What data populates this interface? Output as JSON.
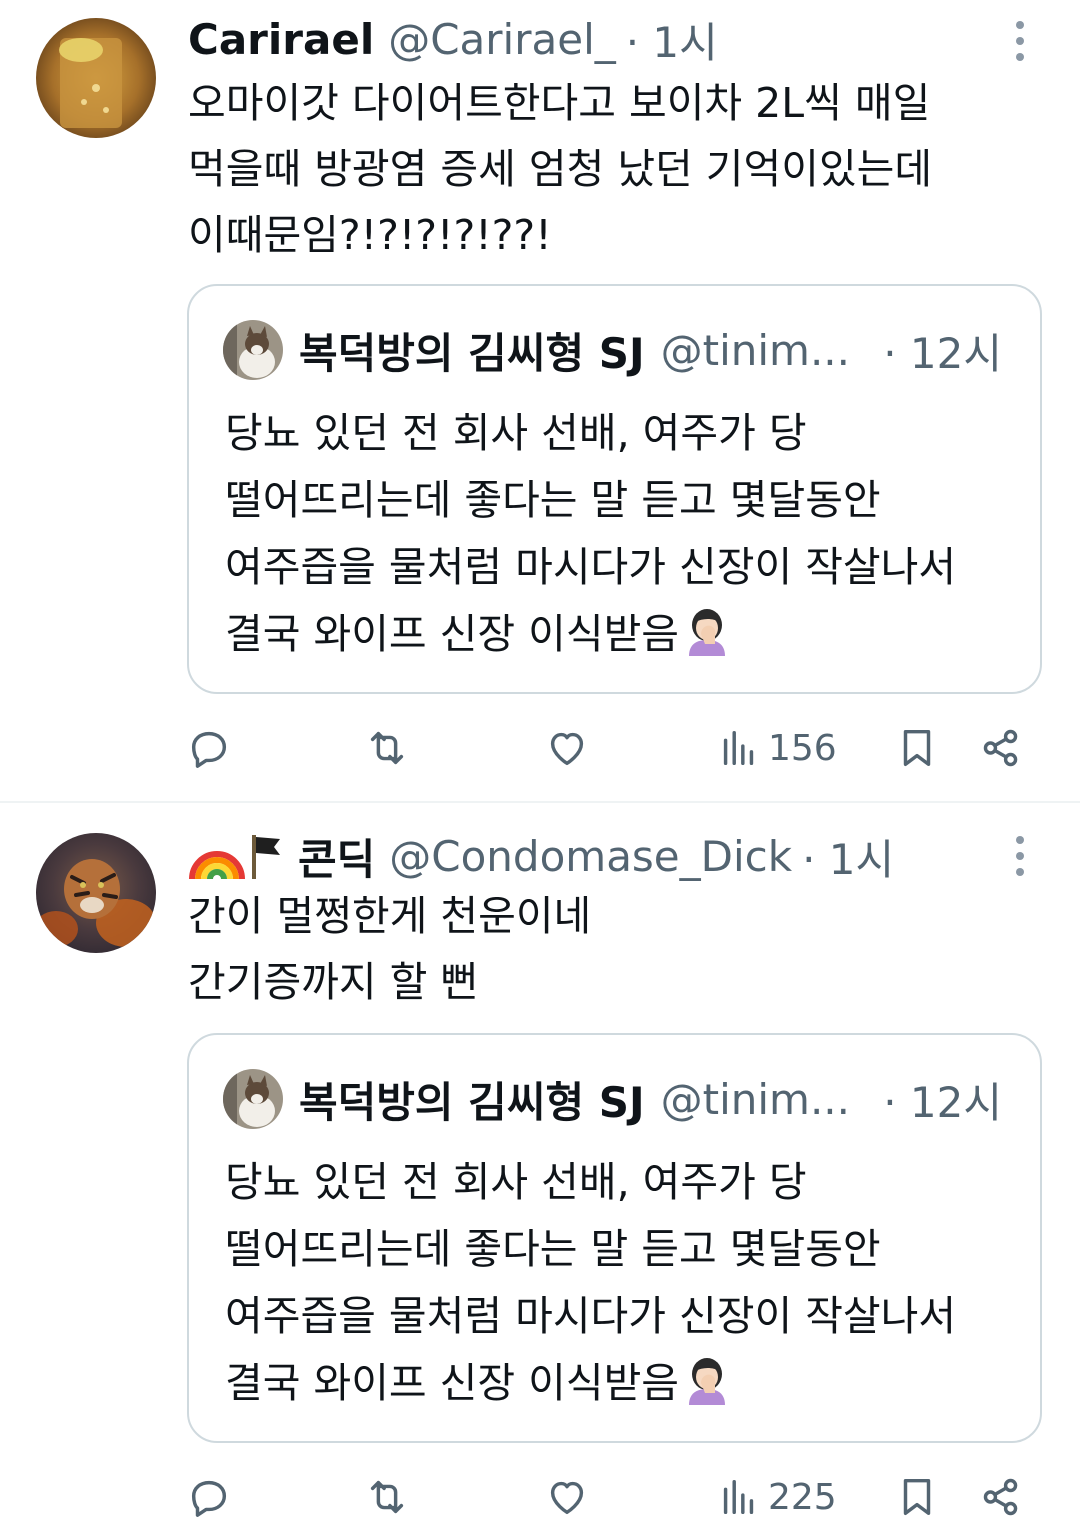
{
  "tweets": [
    {
      "author_name": "Carirael",
      "author_handle": "@Carirael_",
      "time": "· 1시",
      "body_lines": [
        "오마이갓 다이어트한다고 보이차 2L씩 매일",
        "먹을때 방광염 증세 엄청 났던 기억이있는데",
        "이때문임?!?!?!?!??!"
      ],
      "quote": {
        "author_name": "복덕방의 김씨형 SJ",
        "author_handle": "@tinim...",
        "time": "· 12시",
        "body_lines": [
          "당뇨 있던 전 회사 선배, 여주가 당",
          "떨어뜨리는데 좋다는 말 듣고 몇달동안",
          "여주즙을 물처럼 마시다가 신장이 작살나서",
          "결국 와이프 신장 이식받음"
        ],
        "emoji": "face-palm-emoji"
      },
      "views": "156"
    },
    {
      "author_prefix": "🌈🏴",
      "author_name": "콘딕",
      "author_handle": "@Condomase_Dick",
      "time": "· 1시",
      "body_lines": [
        "간이 멀쩡한게 천운이네",
        "간기증까지 할 뻔"
      ],
      "quote": {
        "author_name": "복덕방의 김씨형 SJ",
        "author_handle": "@tinim...",
        "time": "· 12시",
        "body_lines": [
          "당뇨 있던 전 회사 선배, 여주가 당",
          "떨어뜨리는데 좋다는 말 듣고 몇달동안",
          "여주즙을 물처럼 마시다가 신장이 작살나서",
          "결국 와이프 신장 이식받음"
        ],
        "emoji": "face-palm-emoji"
      },
      "views": "225"
    }
  ],
  "icons": {
    "reply": "reply-icon",
    "retweet": "retweet-icon",
    "like": "like-icon",
    "views": "views-icon",
    "bookmark": "bookmark-icon",
    "share": "share-icon",
    "more": "more-icon"
  },
  "colors": {
    "text": "#0f1419",
    "secondary": "#536471",
    "border": "#cfd9de",
    "icon": "#536471"
  }
}
